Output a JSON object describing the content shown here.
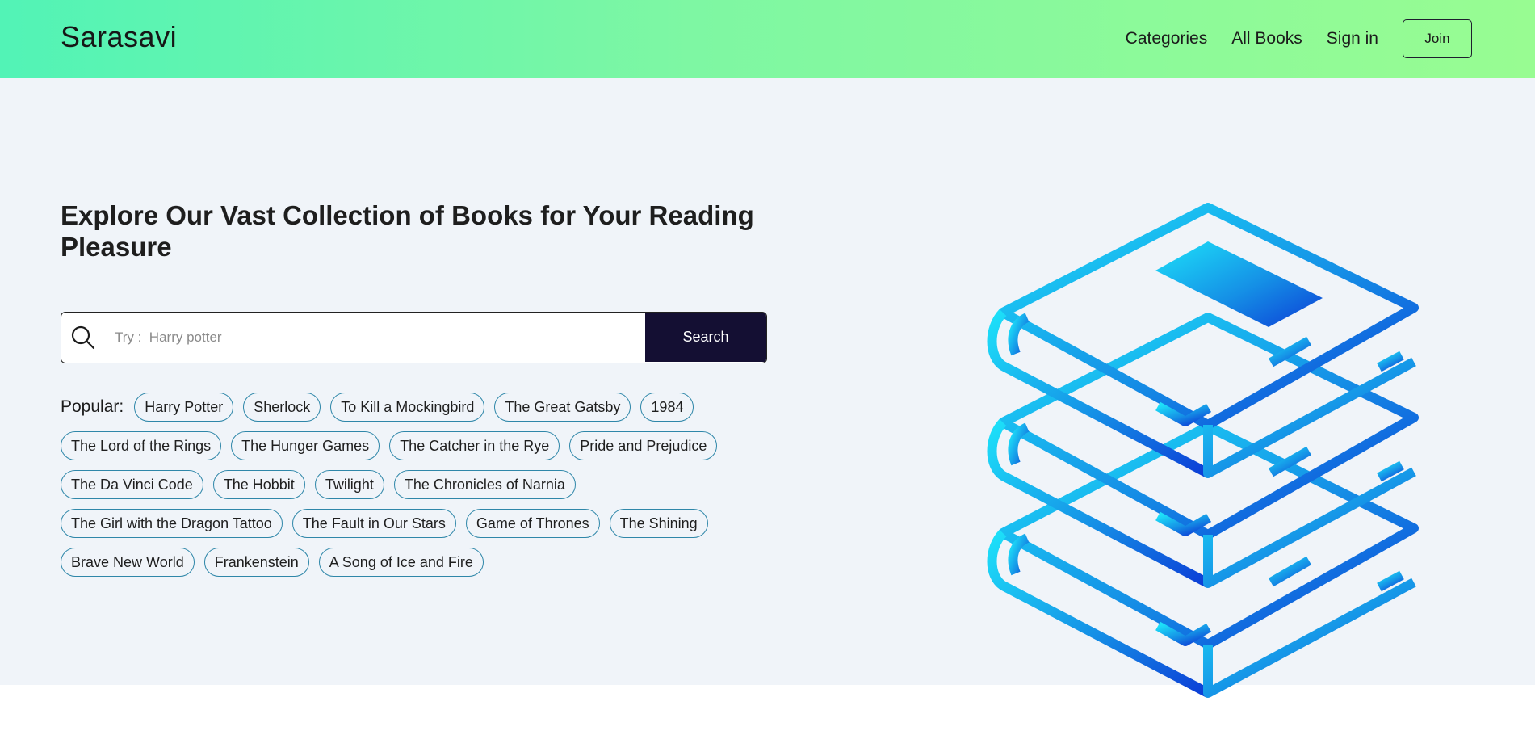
{
  "header": {
    "brand": "Sarasavi",
    "nav": [
      {
        "label": "Categories"
      },
      {
        "label": "All Books"
      },
      {
        "label": "Sign in"
      }
    ],
    "join_label": "Join"
  },
  "hero": {
    "title": "Explore Our Vast Collection of Books for Your Reading Pleasure",
    "search": {
      "placeholder": "Try :  Harry potter",
      "value": "",
      "button_label": "Search",
      "icon": "search-icon"
    },
    "popular_label": "Popular:",
    "popular_tags": [
      "Harry Potter",
      "Sherlock",
      "To Kill a Mockingbird",
      "The Great Gatsby",
      "1984",
      "The Lord of the Rings",
      "The Hunger Games",
      "The Catcher in the Rye",
      "Pride and Prejudice",
      "The Da Vinci Code",
      "The Hobbit",
      "Twilight",
      "The Chronicles of Narnia",
      "The Girl with the Dragon Tattoo",
      "The Fault in Our Stars",
      "Game of Thrones",
      "The Shining",
      "Brave New World",
      "Frankenstein",
      "A Song of Ice and Fire"
    ],
    "illustration_icon": "book-stack-icon"
  },
  "colors": {
    "header_gradient_start": "#52f3b6",
    "header_gradient_end": "#98fc92",
    "hero_background": "#f0f4f9",
    "search_button": "#140f33",
    "tag_border": "#2f87a9",
    "illustration_gradient_start": "#1de1f9",
    "illustration_gradient_end": "#0c3dd6"
  }
}
